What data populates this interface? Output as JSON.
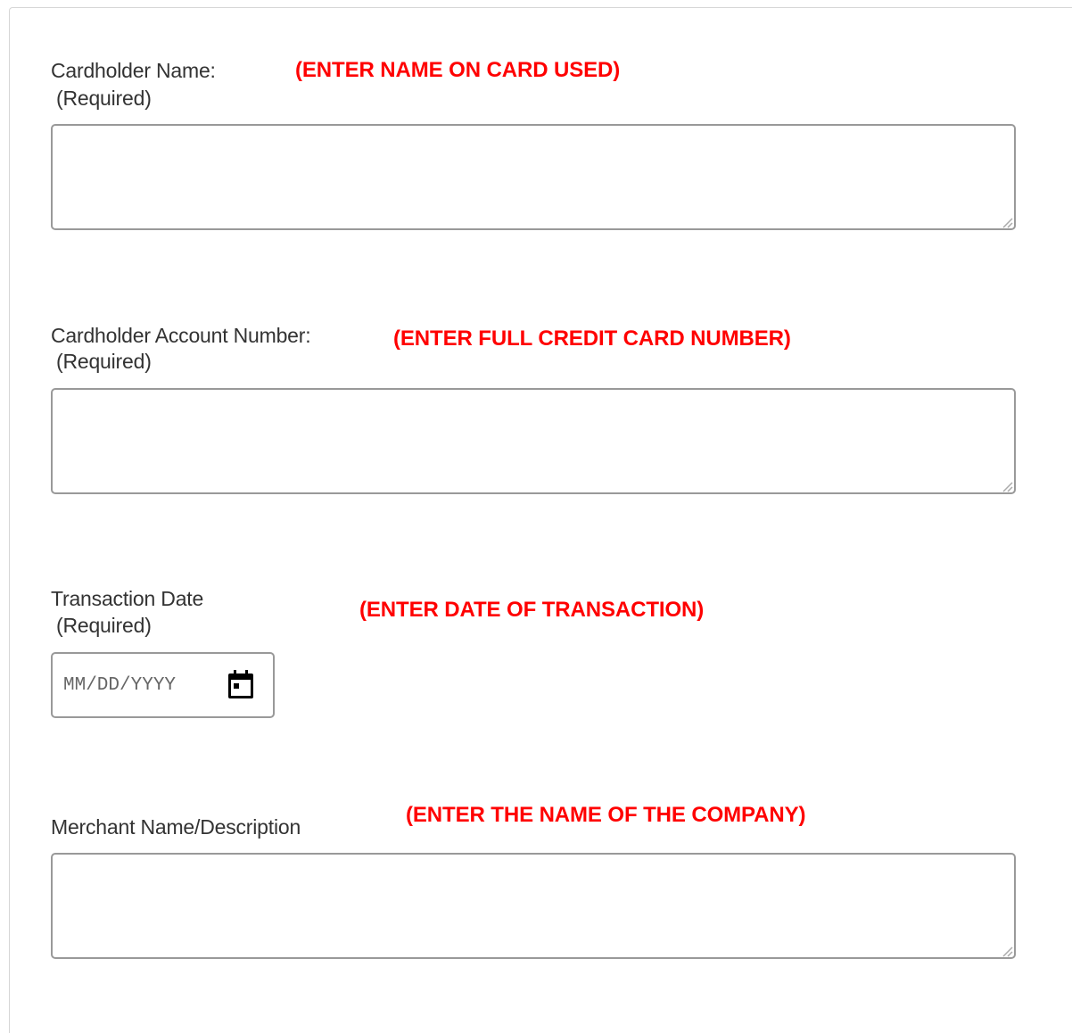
{
  "fields": {
    "cardholder_name": {
      "label": "Cardholder Name:",
      "required": "(Required)",
      "hint": "(ENTER NAME ON CARD USED)",
      "value": ""
    },
    "account_number": {
      "label": "Cardholder Account Number:",
      "required": "(Required)",
      "hint": "(ENTER FULL CREDIT CARD NUMBER)",
      "value": ""
    },
    "transaction_date": {
      "label": "Transaction Date",
      "required": "(Required)",
      "hint": "(ENTER DATE OF TRANSACTION)",
      "placeholder": "MM/DD/YYYY",
      "icon": "calendar-icon"
    },
    "merchant": {
      "label": "Merchant Name/Description",
      "hint": "(ENTER THE NAME OF THE COMPANY)",
      "value": ""
    }
  },
  "colors": {
    "hint": "#ff0000",
    "label": "#333333",
    "border": "#999999"
  }
}
